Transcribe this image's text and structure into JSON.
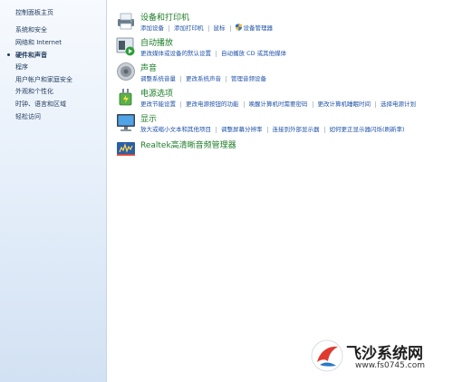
{
  "sidebar": {
    "home": "控制面板主页",
    "items": [
      {
        "label": "系统和安全"
      },
      {
        "label": "网络和 Internet"
      },
      {
        "label": "硬件和声音"
      },
      {
        "label": "程序"
      },
      {
        "label": "用户帐户和家庭安全"
      },
      {
        "label": "外观和个性化"
      },
      {
        "label": "时钟、语言和区域"
      },
      {
        "label": "轻松访问"
      }
    ],
    "active_item": "硬件和声音"
  },
  "categories": [
    {
      "title": "设备和打印机",
      "icon": "printer-icon",
      "links": [
        "添加设备",
        "添加打印机",
        "鼠标",
        "设备管理器"
      ]
    },
    {
      "title": "自动播放",
      "icon": "autoplay-icon",
      "links": [
        "更改媒体或设备的默认设置",
        "自动播放 CD 或其他媒体"
      ]
    },
    {
      "title": "声音",
      "icon": "speaker-icon",
      "links": [
        "调整系统音量",
        "更改系统声音",
        "管理音频设备"
      ]
    },
    {
      "title": "电源选项",
      "icon": "power-icon",
      "links": [
        "更改节能设置",
        "更改电源按钮的功能",
        "唤醒计算机时需要密码",
        "更改计算机睡眠时间",
        "选择电源计划"
      ]
    },
    {
      "title": "显示",
      "icon": "display-icon",
      "links": [
        "放大或缩小文本和其他项目",
        "调整屏幕分辨率",
        "连接到外部显示器",
        "如何更正显示器闪烁(刷新率)"
      ]
    },
    {
      "title": "Realtek高清晰音频管理器",
      "icon": "realtek-audio-icon",
      "links": []
    }
  ],
  "colors": {
    "category_title": "#1e7d28",
    "link": "#1f52a8",
    "nav_text": "#1e395b"
  },
  "watermark": {
    "title": "飞沙系统网",
    "url": "www.fs0745.com"
  }
}
